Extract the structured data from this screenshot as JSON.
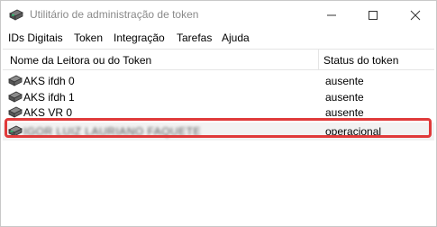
{
  "window": {
    "title": "Utilitário de administração de token",
    "icon": "token-card-icon"
  },
  "menu": {
    "items": [
      "IDs Digitais",
      "Token",
      "Integração",
      "Tarefas",
      "Ajuda"
    ]
  },
  "table": {
    "columns": [
      "Nome da Leitora ou do Token",
      "Status do token"
    ],
    "rows": [
      {
        "name": "AKS ifdh 0",
        "status": "ausente",
        "icon": "card-reader-icon"
      },
      {
        "name": "AKS ifdh 1",
        "status": "ausente",
        "icon": "card-reader-icon"
      },
      {
        "name": "AKS VR 0",
        "status": "ausente",
        "icon": "card-reader-icon"
      },
      {
        "name": "IGOR LUIZ LAURIANO FAQUETE",
        "status": "operacional",
        "icon": "token-device-icon",
        "selected": true
      }
    ]
  },
  "colors": {
    "highlight": "#e03a3a",
    "title_text": "#8a8a8a"
  }
}
